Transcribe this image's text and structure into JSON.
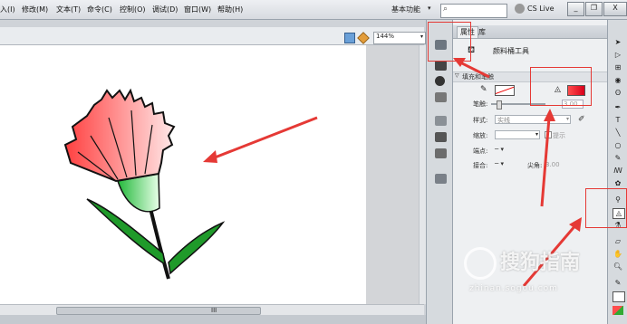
{
  "menu": {
    "items": [
      "入(I)",
      "修改(M)",
      "文本(T)",
      "命令(C)",
      "控制(O)",
      "调试(D)",
      "窗口(W)",
      "帮助(H)"
    ]
  },
  "titlebar": {
    "workspace": "基本功能",
    "cs_live": "CS Live",
    "window_buttons": [
      "_",
      "❐",
      "X"
    ]
  },
  "stage": {
    "zoom": "144%",
    "hscroll_label": "III"
  },
  "panel": {
    "tabs": [
      "属性",
      "库"
    ],
    "tool_name": "颜料桶工具",
    "section_title": "填充和笔触",
    "stroke_label": "笔触:",
    "stroke_value": "3.00",
    "style_label": "样式:",
    "style_value": "实线",
    "scale_label": "缩放:",
    "hinting_label": "提示",
    "cap_label": "端点:",
    "join_label": "接合:",
    "miter_label": "尖角:",
    "miter_value": "3.00"
  },
  "watermark": {
    "text": "搜狗指南",
    "url": "zhinan.sogou.com"
  },
  "colors": {
    "highlight": "#e53935",
    "fill_start": "#ff4d4d",
    "fill_end": "#d9001b",
    "stage": "#ffffff"
  }
}
